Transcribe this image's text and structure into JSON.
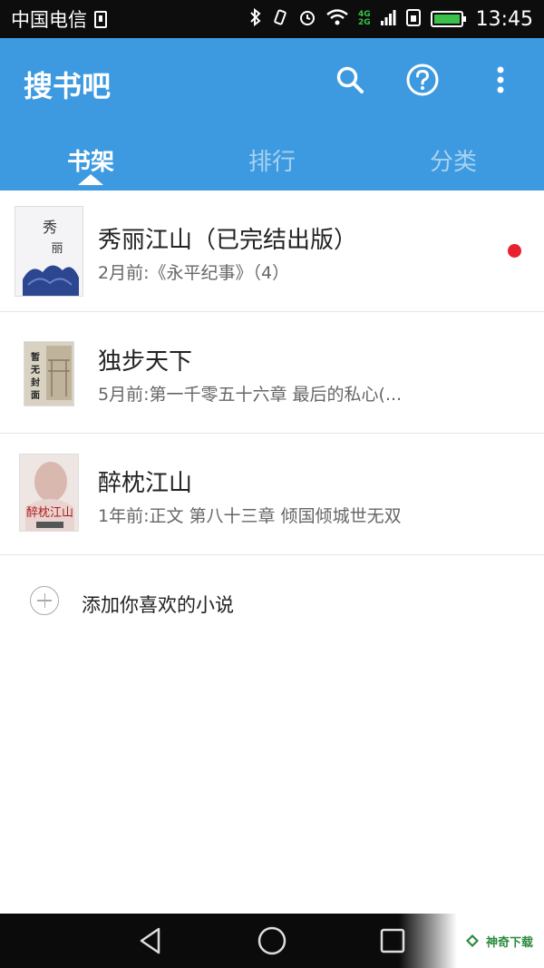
{
  "status_bar": {
    "carrier": "中国电信",
    "network_tags": [
      "4G",
      "2G"
    ],
    "time": "13:45",
    "battery_level": 0.8
  },
  "app_bar": {
    "title": "搜书吧",
    "tabs": [
      {
        "label": "书架",
        "active": true
      },
      {
        "label": "排行",
        "active": false
      },
      {
        "label": "分类",
        "active": false
      }
    ]
  },
  "books": [
    {
      "title": "秀丽江山（已完结出版）",
      "meta": "2月前:《永平纪事》（4）",
      "has_update_dot": true,
      "cover_text": "秀丽江山"
    },
    {
      "title": "独步天下",
      "meta": "5月前:第一千零五十六章 最后的私心(...",
      "has_update_dot": false,
      "cover_text": "暂无封面"
    },
    {
      "title": "醉枕江山",
      "meta": "1年前:正文 第八十三章 倾国倾城世无双",
      "has_update_dot": false,
      "cover_text": "醉枕江山"
    }
  ],
  "add_book_label": "添加你喜欢的小说",
  "watermark": "神奇下载",
  "colors": {
    "accent": "#3d9ae0",
    "badge": "#e8212e",
    "watermark": "#2b8a3e"
  }
}
